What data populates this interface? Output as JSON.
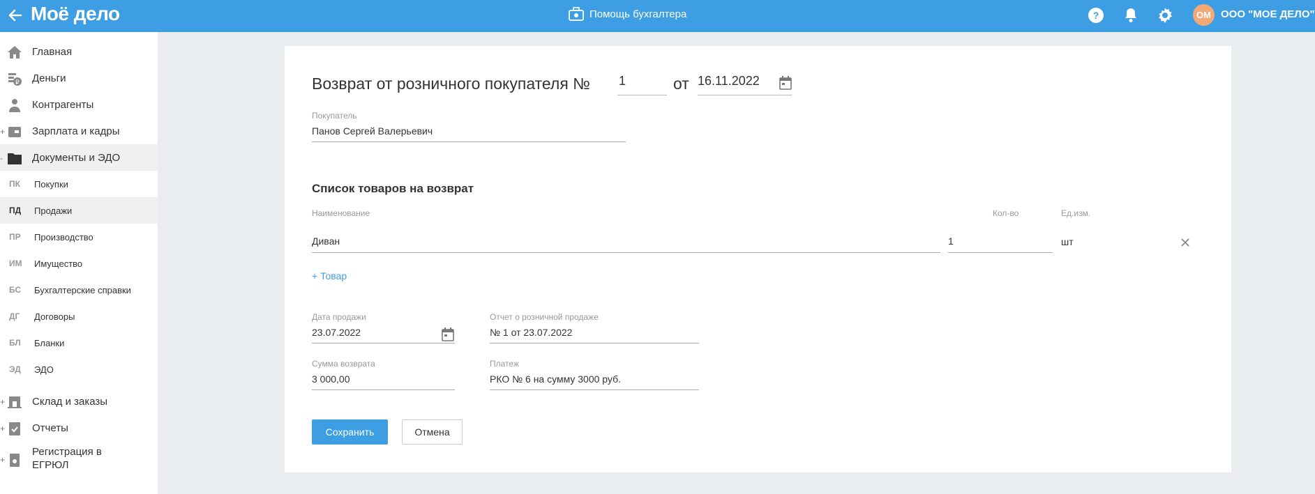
{
  "header": {
    "logo": "Моё дело",
    "help_center": "Помощь бухгалтера",
    "avatar_initials": "ОМ",
    "company": "ООО \"МОЕ ДЕЛО\""
  },
  "sidebar": {
    "items": [
      {
        "label": "Главная",
        "icon": "home-icon"
      },
      {
        "label": "Деньги",
        "icon": "money-icon"
      },
      {
        "label": "Контрагенты",
        "icon": "contractors-icon"
      },
      {
        "label": "Зарплата и кадры",
        "icon": "salary-icon"
      },
      {
        "label": "Документы и ЭДО",
        "icon": "folder-icon"
      },
      {
        "label": "Склад и заказы",
        "icon": "warehouse-icon"
      },
      {
        "label": "Отчеты",
        "icon": "reports-icon"
      },
      {
        "label": "Регистрация в ЕГРЮЛ",
        "icon": "registration-icon"
      }
    ],
    "sub_items": [
      {
        "abbr": "ПК",
        "label": "Покупки"
      },
      {
        "abbr": "ПД",
        "label": "Продажи"
      },
      {
        "abbr": "ПР",
        "label": "Производство"
      },
      {
        "abbr": "ИМ",
        "label": "Имущество"
      },
      {
        "abbr": "БС",
        "label": "Бухгалтерские справки"
      },
      {
        "abbr": "ДГ",
        "label": "Договоры"
      },
      {
        "abbr": "БЛ",
        "label": "Бланки"
      },
      {
        "abbr": "ЭД",
        "label": "ЭДО"
      }
    ]
  },
  "form": {
    "title": "Возврат от розничного покупателя №",
    "number": "1",
    "from_label": "от",
    "date": "16.11.2022",
    "buyer_label": "Покупатель",
    "buyer_value": "Панов Сергей Валерьевич",
    "goods_title": "Список товаров на возврат",
    "columns": {
      "name": "Наименование",
      "qty": "Кол-во",
      "unit": "Ед.изм."
    },
    "items": [
      {
        "name": "Диван",
        "qty": "1",
        "unit": "шт"
      }
    ],
    "add_item": "+ Товар",
    "sale_date_label": "Дата продажи",
    "sale_date_value": "23.07.2022",
    "report_label": "Отчет о розничной продаже",
    "report_value": "№ 1 от 23.07.2022",
    "refund_label": "Сумма возврата",
    "refund_value": "3 000,00",
    "payment_label": "Платеж",
    "payment_value": "РКО № 6 на сумму 3000 руб.",
    "save_button": "Сохранить",
    "cancel_button": "Отмена"
  },
  "colors": {
    "accent": "#3d9ee4",
    "avatar": "#f5a877"
  }
}
